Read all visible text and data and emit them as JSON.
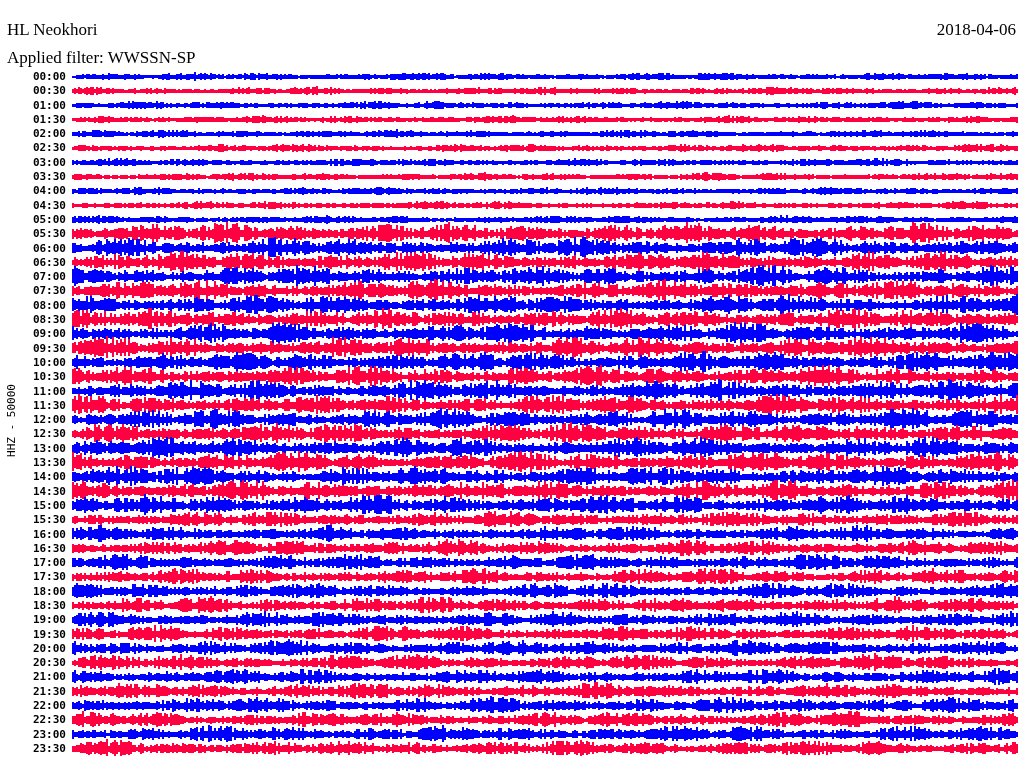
{
  "station": "HL Neokhori",
  "date": "2018-04-06",
  "filter": "Applied filter: WWSSN-SP",
  "channel_label": "HHZ - 50000",
  "rows": [
    {
      "time": "00:00",
      "color": "#0000ff"
    },
    {
      "time": "00:30",
      "color": "#ff0040"
    },
    {
      "time": "01:00",
      "color": "#0000ff"
    },
    {
      "time": "01:30",
      "color": "#ff0040"
    },
    {
      "time": "02:00",
      "color": "#0000ff"
    },
    {
      "time": "02:30",
      "color": "#ff0040"
    },
    {
      "time": "03:00",
      "color": "#0000ff"
    },
    {
      "time": "03:30",
      "color": "#ff0040"
    },
    {
      "time": "04:00",
      "color": "#0000ff"
    },
    {
      "time": "04:30",
      "color": "#ff0040"
    },
    {
      "time": "05:00",
      "color": "#0000ff"
    },
    {
      "time": "05:30",
      "color": "#ff0040"
    },
    {
      "time": "06:00",
      "color": "#0000ff"
    },
    {
      "time": "06:30",
      "color": "#ff0040"
    },
    {
      "time": "07:00",
      "color": "#0000ff"
    },
    {
      "time": "07:30",
      "color": "#ff0040"
    },
    {
      "time": "08:00",
      "color": "#0000ff"
    },
    {
      "time": "08:30",
      "color": "#ff0040"
    },
    {
      "time": "09:00",
      "color": "#0000ff"
    },
    {
      "time": "09:30",
      "color": "#ff0040"
    },
    {
      "time": "10:00",
      "color": "#0000ff"
    },
    {
      "time": "10:30",
      "color": "#ff0040"
    },
    {
      "time": "11:00",
      "color": "#0000ff"
    },
    {
      "time": "11:30",
      "color": "#ff0040"
    },
    {
      "time": "12:00",
      "color": "#0000ff"
    },
    {
      "time": "12:30",
      "color": "#ff0040"
    },
    {
      "time": "13:00",
      "color": "#0000ff"
    },
    {
      "time": "13:30",
      "color": "#ff0040"
    },
    {
      "time": "14:00",
      "color": "#0000ff"
    },
    {
      "time": "14:30",
      "color": "#ff0040"
    },
    {
      "time": "15:00",
      "color": "#0000ff"
    },
    {
      "time": "15:30",
      "color": "#ff0040"
    },
    {
      "time": "16:00",
      "color": "#0000ff"
    },
    {
      "time": "16:30",
      "color": "#ff0040"
    },
    {
      "time": "17:00",
      "color": "#0000ff"
    },
    {
      "time": "17:30",
      "color": "#ff0040"
    },
    {
      "time": "18:00",
      "color": "#0000ff"
    },
    {
      "time": "18:30",
      "color": "#ff0040"
    },
    {
      "time": "19:00",
      "color": "#0000ff"
    },
    {
      "time": "19:30",
      "color": "#ff0040"
    },
    {
      "time": "20:00",
      "color": "#0000ff"
    },
    {
      "time": "20:30",
      "color": "#ff0040"
    },
    {
      "time": "21:00",
      "color": "#0000ff"
    },
    {
      "time": "21:30",
      "color": "#ff0040"
    },
    {
      "time": "22:00",
      "color": "#0000ff"
    },
    {
      "time": "22:30",
      "color": "#ff0040"
    },
    {
      "time": "23:00",
      "color": "#0000ff"
    },
    {
      "time": "23:30",
      "color": "#ff0040"
    }
  ]
}
